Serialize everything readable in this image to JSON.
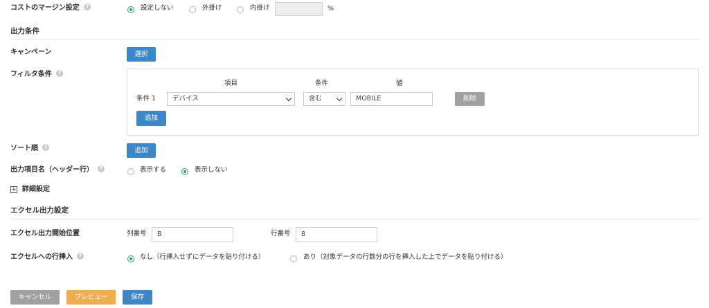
{
  "cost_margin": {
    "label": "コストのマージン設定",
    "options": [
      "設定しない",
      "外掛け",
      "内掛け"
    ],
    "selected": "設定しない",
    "value": "",
    "unit": "%"
  },
  "output_conditions": {
    "heading": "出力条件",
    "campaign": {
      "label": "キャンペーン",
      "select_button": "選択"
    },
    "filter": {
      "label": "フィルタ条件",
      "headers": {
        "item": "項目",
        "condition": "条件",
        "value": "値"
      },
      "rows": [
        {
          "label": "条件 1",
          "item": "デバイス",
          "condition": "含む",
          "value": "MOBILE",
          "delete_button": "削除"
        }
      ],
      "add_button": "追加"
    },
    "sort": {
      "label": "ソート順",
      "add_button": "追加"
    },
    "header_row": {
      "label": "出力項目名（ヘッダー行）",
      "options": [
        "表示する",
        "表示しない"
      ],
      "selected": "表示しない"
    },
    "advanced": {
      "label": "詳細設定"
    }
  },
  "excel": {
    "heading": "エクセル出力設定",
    "start_position": {
      "label": "エクセル出力開始位置",
      "column_label": "列番号",
      "column_value": "B",
      "row_label": "行番号",
      "row_value": "8"
    },
    "row_insert": {
      "label": "エクセルへの行挿入",
      "options": [
        "なし（行挿入せずにデータを貼り付ける）",
        "あり（対象データの行数分の行を挿入した上でデータを貼り付ける）"
      ],
      "selected": "なし（行挿入せずにデータを貼り付ける）"
    }
  },
  "footer": {
    "cancel": "キャンセル",
    "preview": "プレビュー",
    "save": "保存"
  },
  "colors": {
    "accent_blue": "#3b87c8",
    "radio_green": "#2aa186",
    "preview_orange": "#f0ad4e",
    "disabled_gray": "#a0a0a0"
  }
}
